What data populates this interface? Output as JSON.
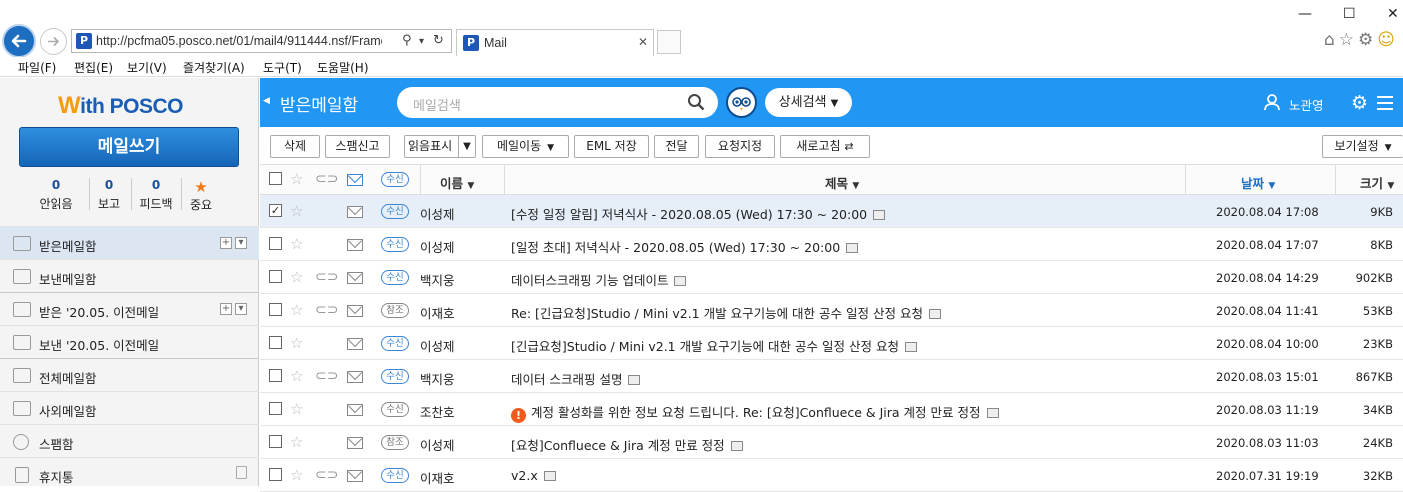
{
  "browser": {
    "url": "http://pcfma05.posco.net/01/mail4/911444.nsf/FrameN",
    "tab_title": "Mail",
    "favicon_letter": "P",
    "menu": [
      "파일(F)",
      "편집(E)",
      "보기(V)",
      "즐겨찾기(A)",
      "도구(T)",
      "도움말(H)"
    ]
  },
  "sidebar": {
    "logo_mark": "W",
    "logo_text": "ith POSCO",
    "compose_label": "메일쓰기",
    "stats": [
      {
        "count": "0",
        "label": "안읽음"
      },
      {
        "count": "0",
        "label": "보고"
      },
      {
        "count": "0",
        "label": "피드백"
      },
      {
        "label": "중요"
      }
    ],
    "folders": [
      "받은메일함",
      "보낸메일함",
      "받은 '20.05. 이전메일",
      "보낸 '20.05. 이전메일",
      "전체메일함",
      "사외메일함",
      "스팸함",
      "휴지통"
    ]
  },
  "header": {
    "title": "받은메일함",
    "search_placeholder": "메일검색",
    "advanced_search": "상세검색",
    "user_name": "노관영"
  },
  "toolbar": {
    "delete": "삭제",
    "spam": "스팸신고",
    "read_mark": "읽음표시",
    "move": "메일이동",
    "eml_save": "EML 저장",
    "forward": "전달",
    "request": "요청지정",
    "refresh": "새로고침",
    "view_settings": "보기설정"
  },
  "columns": {
    "tag": "수신",
    "name": "이름",
    "subject": "제목",
    "date": "날짜",
    "size": "크기"
  },
  "emails": [
    {
      "tag": "수신",
      "name": "이성제",
      "subject": "[수정 일정 알림] 저녁식사 - 2020.08.05 (Wed) 17:30 ~ 20:00",
      "date": "2020.08.04 17:08",
      "size": "9KB"
    },
    {
      "tag": "수신",
      "name": "이성제",
      "subject": "[일정 초대] 저녁식사 - 2020.08.05 (Wed) 17:30 ~ 20:00",
      "date": "2020.08.04 17:07",
      "size": "8KB"
    },
    {
      "tag": "수신",
      "name": "백지웅",
      "subject": "데이터스크래핑 기능 업데이트",
      "date": "2020.08.04 14:29",
      "size": "902KB"
    },
    {
      "tag": "참조",
      "name": "이재호",
      "subject": "Re: [긴급요청]Studio / Mini v2.1 개발 요구기능에 대한 공수 일정 산정 요청",
      "date": "2020.08.04 11:41",
      "size": "53KB"
    },
    {
      "tag": "수신",
      "name": "이성제",
      "subject": "[긴급요청]Studio / Mini v2.1 개발 요구기능에 대한 공수 일정 산정 요청",
      "date": "2020.08.04 10:00",
      "size": "23KB"
    },
    {
      "tag": "수신",
      "name": "백지웅",
      "subject": "데이터 스크래핑 설명",
      "date": "2020.08.03 15:01",
      "size": "867KB"
    },
    {
      "tag": "수신",
      "name": "조찬호",
      "subject": "계정 활성화를 위한 정보 요청 드립니다. Re: [요청]Confluece & Jira 계정 만료 정정",
      "date": "2020.08.03 11:19",
      "size": "34KB"
    },
    {
      "tag": "참조",
      "name": "이성제",
      "subject": "[요청]Confluece & Jira 계정 만료 정정",
      "date": "2020.08.03 11:03",
      "size": "24KB"
    },
    {
      "tag": "수신",
      "name": "이재호",
      "subject": "v2.x",
      "date": "2020.07.31 19:19",
      "size": "32KB"
    }
  ]
}
